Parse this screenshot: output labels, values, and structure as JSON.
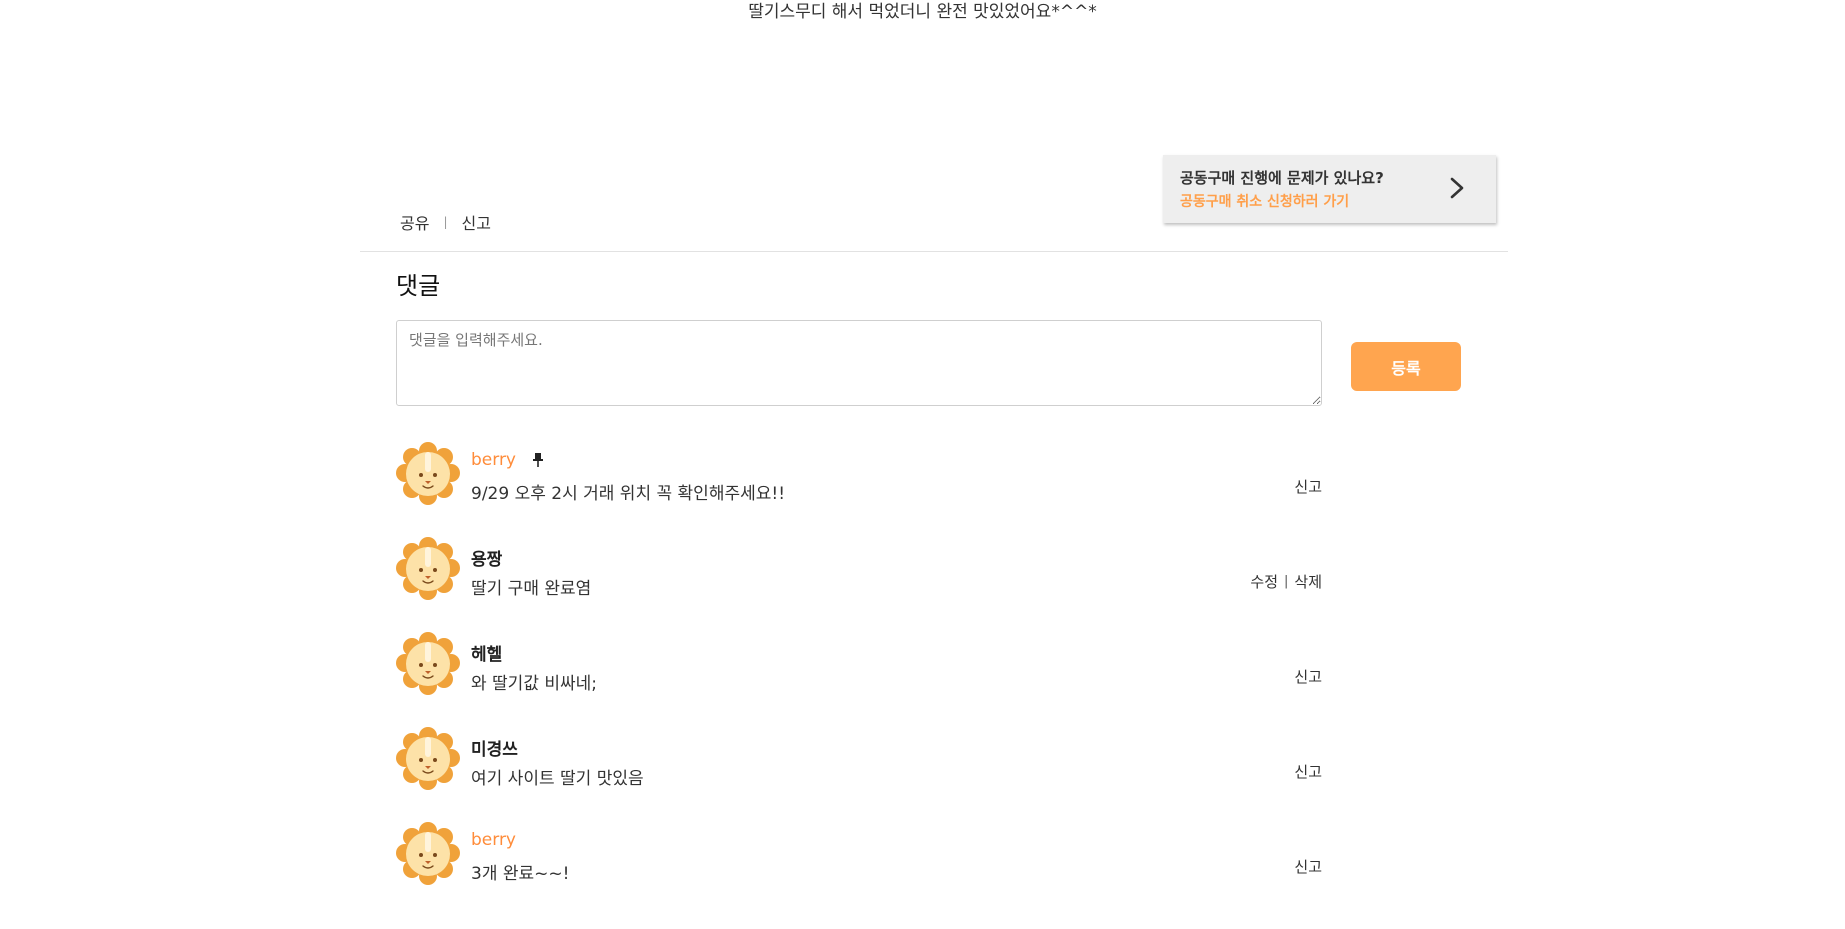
{
  "post": {
    "body": "딸기스무디 해서 먹었더니 완전 맛있었어요*^^*",
    "share_label": "공유",
    "report_label": "신고",
    "separator": "|"
  },
  "cancel_banner": {
    "question": "공동구매 진행에 문제가 있나요?",
    "link": "공동구매 취소 신청하러 가기",
    "icon": "chevron-right-icon"
  },
  "comments_section": {
    "title": "댓글",
    "input_placeholder": "댓글을 입력해주세요.",
    "input_value": "",
    "submit_label": "등록"
  },
  "colors": {
    "accent": "#ffa54f",
    "owner_name": "#ff8c3a",
    "banner_bg": "#eeeeee"
  },
  "comments": [
    {
      "author": "berry",
      "is_owner": true,
      "pinned": true,
      "pin_icon": "pin-icon",
      "avatar_icon": "lion-avatar-icon",
      "text": "9/29 오후 2시 거래 위치 꼭 확인해주세요!!",
      "actions": [
        "신고"
      ]
    },
    {
      "author": "용짱",
      "is_owner": false,
      "pinned": false,
      "avatar_icon": "lion-avatar-icon",
      "text": "딸기 구매 완료염",
      "actions": [
        "수정",
        "삭제"
      ]
    },
    {
      "author": "헤헬",
      "is_owner": false,
      "pinned": false,
      "avatar_icon": "lion-avatar-icon",
      "text": "와 딸기값 비싸네;",
      "actions": [
        "신고"
      ]
    },
    {
      "author": "미경쓰",
      "is_owner": false,
      "pinned": false,
      "avatar_icon": "lion-avatar-icon",
      "text": "여기 사이트 딸기 맛있음",
      "actions": [
        "신고"
      ]
    },
    {
      "author": "berry",
      "is_owner": true,
      "pinned": false,
      "avatar_icon": "lion-avatar-icon",
      "text": "3개 완료~~!",
      "actions": [
        "신고"
      ]
    }
  ]
}
